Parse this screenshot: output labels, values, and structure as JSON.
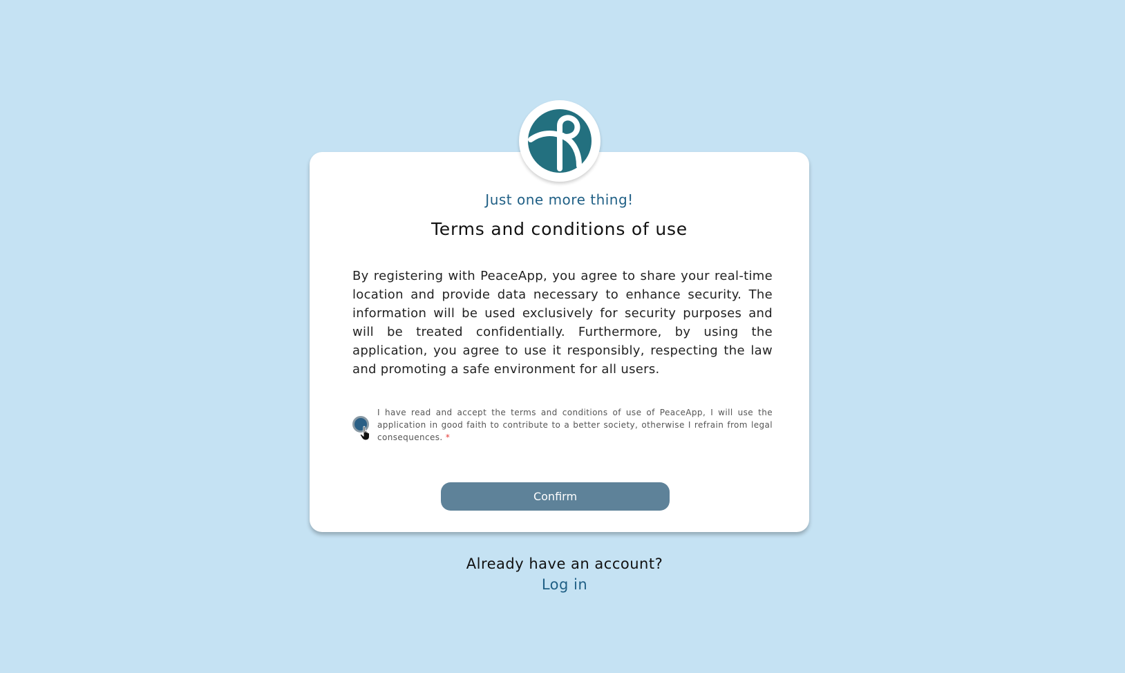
{
  "app": {
    "logo_icon": "peaceapp-logo-icon",
    "brand_color": "#23707f",
    "accent_color": "#1f5f85",
    "background_color": "#c5e2f3"
  },
  "card": {
    "subtitle": "Just one more thing!",
    "title": "Terms and conditions of use",
    "body": "By registering with PeaceApp, you agree to share your real-time location and provide data necessary to enhance security. The information will be used exclusively for security purposes and will be treated confidentially. Furthermore, by using the application, you agree to use it responsibly, respecting the law and promoting a safe environment for all users.",
    "consent": {
      "label": "I have read and accept the terms and conditions of use of PeaceApp, I will use the application in good faith to contribute to a better society, otherwise I refrain from legal consequences.",
      "required_marker": "*",
      "checked": true
    },
    "confirm_label": "Confirm"
  },
  "footer": {
    "prompt": "Already have an account?",
    "login_label": "Log in"
  }
}
